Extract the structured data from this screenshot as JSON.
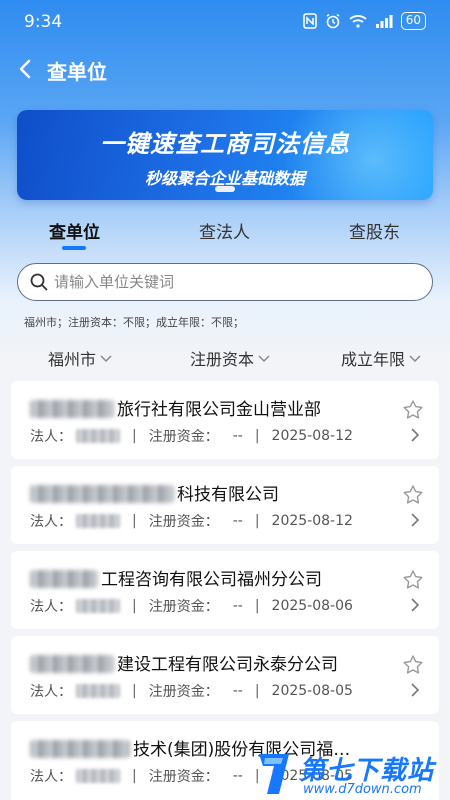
{
  "status_bar": {
    "time": "9:34",
    "battery": "60",
    "icons": [
      "nfc-icon",
      "alarm-icon",
      "wifi-icon",
      "signal-icon",
      "battery-icon"
    ]
  },
  "header": {
    "title": "查单位"
  },
  "banner": {
    "title": "一键速查工商司法信息",
    "subtitle": "秒级聚合企业基础数据"
  },
  "tabs": [
    {
      "label": "查单位",
      "active": true
    },
    {
      "label": "查法人",
      "active": false
    },
    {
      "label": "查股东",
      "active": false
    }
  ],
  "search": {
    "placeholder": "请输入单位关键词",
    "value": ""
  },
  "filter_summary": "福州市；注册资本：不限；成立年限：不限；",
  "filters": [
    {
      "label": "福州市"
    },
    {
      "label": "注册资本"
    },
    {
      "label": "成立年限"
    }
  ],
  "results": [
    {
      "name_suffix": "旅行社有限公司金山营业部",
      "rep_label": "法人：",
      "capital_label": "注册资金：",
      "capital": "--",
      "date": "2025-08-12"
    },
    {
      "name_suffix": "科技有限公司",
      "rep_label": "法人：",
      "capital_label": "注册资金：",
      "capital": "--",
      "date": "2025-08-12"
    },
    {
      "name_suffix": "工程咨询有限公司福州分公司",
      "rep_label": "法人：",
      "capital_label": "注册资金：",
      "capital": "--",
      "date": "2025-08-06"
    },
    {
      "name_suffix": "建设工程有限公司永泰分公司",
      "rep_label": "法人：",
      "capital_label": "注册资金：",
      "capital": "--",
      "date": "2025-08-05"
    },
    {
      "name_suffix": "技术(集团)股份有限公司福…",
      "rep_label": "法人：",
      "capital_label": "注册资金：",
      "capital": "--",
      "date": "2025-08-05"
    }
  ],
  "watermark": {
    "brand": "第七下载站",
    "url": "www.d7down.com"
  },
  "colors": {
    "accent": "#1677ff",
    "header_bg": "#2f8cf0",
    "page_bg": "#f2f4f7"
  }
}
